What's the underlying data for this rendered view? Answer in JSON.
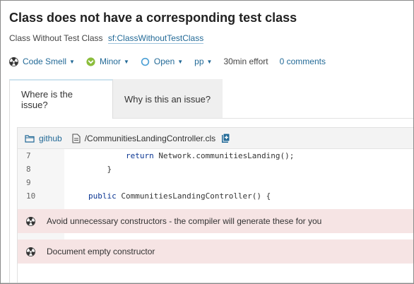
{
  "issue": {
    "title": "Class does not have a corresponding test class",
    "rule_name": "Class Without Test Class",
    "rule_key": "sf:ClassWithoutTestClass"
  },
  "meta": {
    "type": "Code Smell",
    "severity": "Minor",
    "status": "Open",
    "assignee": "pp",
    "effort": "30min effort",
    "comments": "0 comments"
  },
  "tabs": [
    {
      "label": "Where is the issue?",
      "active": true
    },
    {
      "label": "Why is this an issue?",
      "active": false
    }
  ],
  "source": {
    "project": "github",
    "file": "/CommunitiesLandingController.cls",
    "lines": [
      {
        "num": "7",
        "indent": "        ",
        "keyword": "return",
        "rest": " Network.communitiesLanding();"
      },
      {
        "num": "8",
        "indent": "    ",
        "keyword": "",
        "rest": "}"
      },
      {
        "num": "9",
        "indent": "",
        "keyword": "",
        "rest": ""
      },
      {
        "num": "10",
        "indent": "",
        "keyword": "public",
        "rest": " CommunitiesLandingController() {"
      }
    ],
    "issues": [
      "Avoid unnecessary constructors - the compiler will generate these for you",
      "Document empty constructor"
    ]
  },
  "colors": {
    "link": "#236a97",
    "issue_bg": "#f6e4e4",
    "minor_green": "#8bbd3c",
    "status_blue": "#4b9fd5"
  },
  "icons": {
    "code_smell": "radiation-icon",
    "minor": "chevron-down-circle-icon",
    "open": "circle-outline-icon",
    "project": "folder-icon",
    "file": "file-icon",
    "copy": "copy-file-icon"
  }
}
